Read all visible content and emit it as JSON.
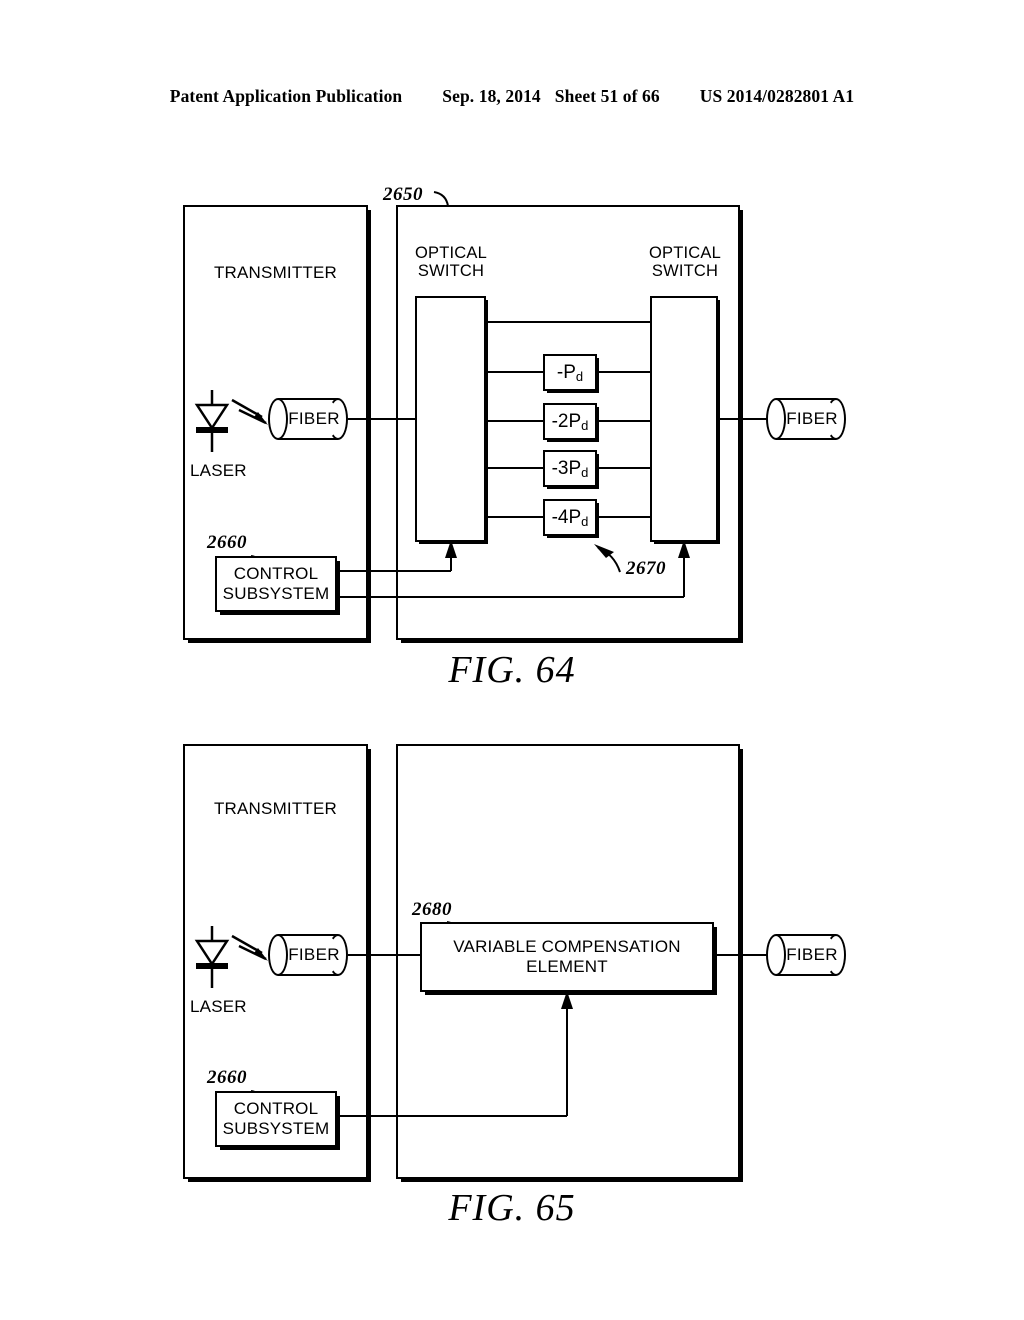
{
  "header": {
    "publication": "Patent Application Publication",
    "date": "Sep. 18, 2014",
    "sheet": "Sheet 51 of 66",
    "docnum": "US 2014/0282801 A1"
  },
  "figures": [
    {
      "caption": "FIG. 64",
      "transmitter": {
        "title": "TRANSMITTER",
        "laser_label": "LASER",
        "fiber_label": "FIBER"
      },
      "system": {
        "ref": "2650",
        "switch_in_label": "OPTICAL\nSWITCH",
        "switch_out_label": "OPTICAL\nSWITCH",
        "compensators": [
          {
            "text": "-P",
            "sub": "d"
          },
          {
            "text": "-2P",
            "sub": "d"
          },
          {
            "text": "-3P",
            "sub": "d"
          },
          {
            "text": "-4P",
            "sub": "d"
          }
        ],
        "compensator_ref": "2670",
        "output_fiber_label": "FIBER"
      },
      "control": {
        "ref": "2660",
        "label": "CONTROL\nSUBSYSTEM"
      }
    },
    {
      "caption": "FIG. 65",
      "transmitter": {
        "title": "TRANSMITTER",
        "laser_label": "LASER",
        "fiber_label": "FIBER"
      },
      "system": {
        "element_ref": "2680",
        "element_label": "VARIABLE COMPENSATION\nELEMENT",
        "output_fiber_label": "FIBER"
      },
      "control": {
        "ref": "2660",
        "label": "CONTROL\nSUBSYSTEM"
      }
    }
  ]
}
